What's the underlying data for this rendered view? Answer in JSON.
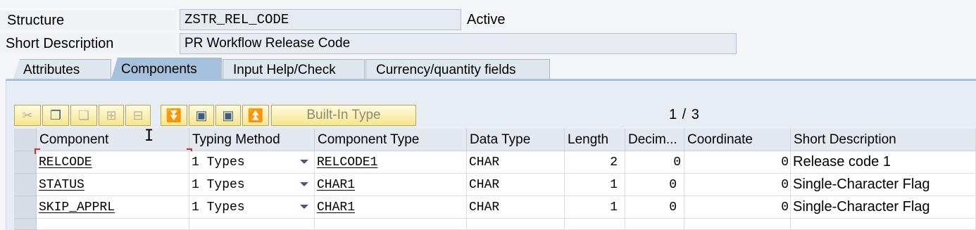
{
  "header": {
    "structure_label": "Structure",
    "structure_value": "ZSTR_REL_CODE",
    "status": "Active",
    "short_desc_label": "Short Description",
    "short_desc_value": "PR Workflow Release Code"
  },
  "tabs": [
    {
      "label": "Attributes",
      "active": false
    },
    {
      "label": "Components",
      "active": true
    },
    {
      "label": "Input Help/Check",
      "active": false
    },
    {
      "label": "Currency/quantity fields",
      "active": false
    }
  ],
  "toolbar": {
    "icons": [
      "cut-icon",
      "copy-icon",
      "paste-icon",
      "insert-row-icon",
      "delete-row-icon",
      "scroll-bottom-icon",
      "scroll-next-icon",
      "scroll-prev-icon",
      "scroll-top-icon"
    ],
    "builtin_type_label": "Built-In Type",
    "accent": "#f6e68c"
  },
  "pager": "1 / 3",
  "table": {
    "columns": [
      "Component",
      "Typing Method",
      "Component Type",
      "Data Type",
      "Length",
      "Decim...",
      "Coordinate",
      "Short Description"
    ],
    "rows": [
      {
        "component": "RELCODE",
        "typing_method": "1 Types",
        "component_type": "RELCODE1",
        "data_type": "CHAR",
        "length": "2",
        "decimals": "0",
        "coordinate": "0",
        "short_description": "Release code 1"
      },
      {
        "component": "STATUS",
        "typing_method": "1 Types",
        "component_type": "CHAR1",
        "data_type": "CHAR",
        "length": "1",
        "decimals": "0",
        "coordinate": "0",
        "short_description": "Single-Character Flag"
      },
      {
        "component": "SKIP_APPRL",
        "typing_method": "1 Types",
        "component_type": "CHAR1",
        "data_type": "CHAR",
        "length": "1",
        "decimals": "0",
        "coordinate": "0",
        "short_description": "Single-Character Flag"
      }
    ]
  }
}
